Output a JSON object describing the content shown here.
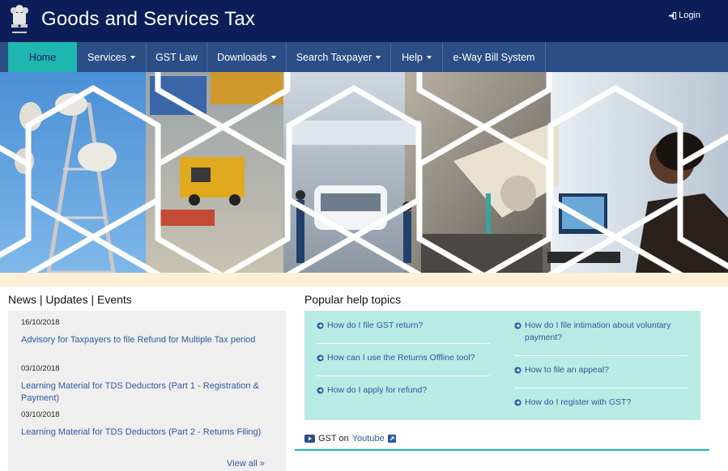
{
  "header": {
    "title": "Goods and Services Tax",
    "login_label": "Login",
    "colors": {
      "header_bg": "#0b1e59",
      "nav_bg": "#2c4e86",
      "accent": "#1fb6b0"
    }
  },
  "nav": {
    "items": [
      {
        "label": "Home",
        "dropdown": false,
        "active": true
      },
      {
        "label": "Services",
        "dropdown": true
      },
      {
        "label": "GST Law",
        "dropdown": false
      },
      {
        "label": "Downloads",
        "dropdown": true
      },
      {
        "label": "Search Taxpayer",
        "dropdown": true
      },
      {
        "label": "Help",
        "dropdown": true
      },
      {
        "label": "e-Way Bill System",
        "dropdown": false
      }
    ]
  },
  "news": {
    "heading": "News | Updates | Events",
    "items": [
      {
        "date": "16/10/2018",
        "title": "Advisory for Taxpayers to file Refund for Multiple Tax period"
      },
      {
        "date": "03/10/2018",
        "title": "Learning Material for TDS Deductors (Part 1 - Registration & Payment)"
      },
      {
        "date": "03/10/2018",
        "title": "Learning Material for TDS Deductors (Part 2 - Returns Filing)"
      }
    ],
    "view_all": "View all »"
  },
  "help": {
    "heading": "Popular help topics",
    "left": [
      "How do I file GST return?",
      "How can I use the Returns Offline tool?",
      "How do I apply for refund?"
    ],
    "right": [
      "How do I file intimation about voluntary payment?",
      "How to file an appeal?",
      "How do I register with GST?"
    ]
  },
  "youtube": {
    "prefix": "GST on",
    "link": "Youtube"
  }
}
